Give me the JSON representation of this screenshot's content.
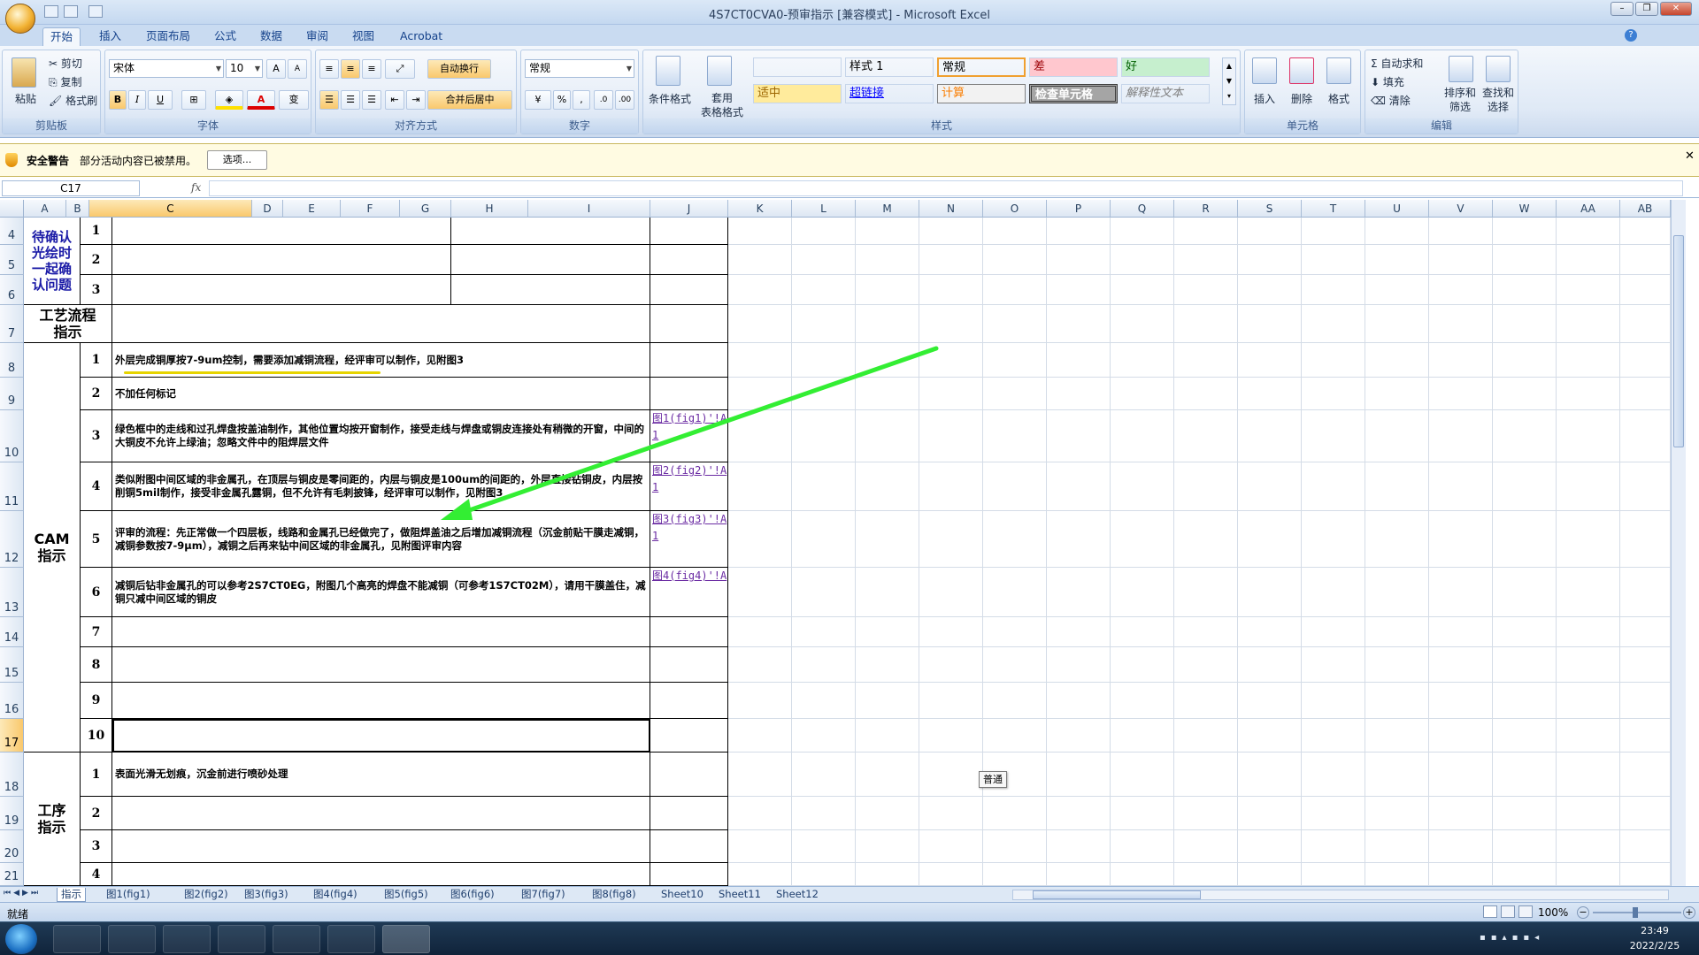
{
  "window": {
    "title": "4S7CT0CVA0-预审指示 [兼容模式] - Microsoft Excel"
  },
  "tabs": [
    "开始",
    "插入",
    "页面布局",
    "公式",
    "数据",
    "审阅",
    "视图",
    "Acrobat"
  ],
  "clipboard": {
    "paste": "粘贴",
    "cut": "剪切",
    "copy": "复制",
    "format_painter": "格式刷",
    "group": "剪贴板"
  },
  "font": {
    "name": "宋体",
    "size": "10",
    "group": "字体",
    "bold": "B",
    "italic": "I",
    "underline": "U",
    "grow": "A",
    "shrink": "A"
  },
  "alignment": {
    "wrap": "自动换行",
    "merge": "合并后居中",
    "group": "对齐方式"
  },
  "number": {
    "format": "常规",
    "group": "数字",
    "percent": "%",
    "comma": ","
  },
  "styles": {
    "conditional": "条件格式",
    "table": "套用\n表格格式",
    "cells": [
      {
        "label": "",
        "bg": "#ffffff",
        "color": "#000000"
      },
      {
        "label": "样式 1",
        "bg": "#ffffff",
        "color": "#000000"
      },
      {
        "label": "常规",
        "bg": "#ffffff",
        "color": "#000000"
      },
      {
        "label": "差",
        "bg": "#ffc7ce",
        "color": "#9c0006"
      },
      {
        "label": "好",
        "bg": "#c6efce",
        "color": "#006100"
      },
      {
        "label": "适中",
        "bg": "#ffeb9c",
        "color": "#9c6500"
      },
      {
        "label": "超链接",
        "bg": "#ffffff",
        "color": "#0000ff"
      },
      {
        "label": "计算",
        "bg": "#f2f2f2",
        "color": "#fa7d00"
      },
      {
        "label": "检查单元格",
        "bg": "#a5a5a5",
        "color": "#ffffff"
      },
      {
        "label": "解释性文本",
        "bg": "#ffffff",
        "color": "#7f7f7f"
      }
    ],
    "group": "样式"
  },
  "cells_group": {
    "insert": "插入",
    "delete": "删除",
    "format": "格式",
    "group": "单元格"
  },
  "editing": {
    "autosum": "自动求和",
    "fill": "填充",
    "clear": "清除",
    "sort": "排序和\n筛选",
    "find": "查找和\n选择",
    "group": "编辑"
  },
  "security": {
    "title": "安全警告",
    "message": "部分活动内容已被禁用。",
    "options": "选项..."
  },
  "formula": {
    "namebox": "C17",
    "fx": "fx",
    "value": ""
  },
  "columns": [
    "A",
    "B",
    "C",
    "D",
    "E",
    "F",
    "G",
    "H",
    "I",
    "J",
    "K",
    "L",
    "M",
    "N",
    "O",
    "P",
    "Q",
    "R",
    "S",
    "T",
    "U",
    "V",
    "W",
    "AA",
    "AB"
  ],
  "rows": [
    "4",
    "5",
    "6",
    "7",
    "8",
    "9",
    "10",
    "11",
    "12",
    "13",
    "14",
    "15",
    "16",
    "17",
    "18",
    "19",
    "20",
    "21"
  ],
  "sheet": {
    "confirm_label": "待确认光绘时一起确认问题",
    "confirm_nums": [
      "1",
      "2",
      "3"
    ],
    "process_label": "工艺流程指示",
    "cam_label": "CAM指示",
    "cam_items": [
      {
        "num": "1",
        "text": "外层完成铜厚按7-9um控制，需要添加减铜流程，经评审可以制作，见附图3",
        "link": ""
      },
      {
        "num": "2",
        "text": "不加任何标记",
        "link": ""
      },
      {
        "num": "3",
        "text": "绿色框中的走线和过孔焊盘按盖油制作，其他位置均按开窗制作，接受走线与焊盘或铜皮连接处有稍微的开窗，中间的大铜皮不允许上绿油；忽略文件中的阻焊层文件",
        "link": "图1(fig1)'!A1"
      },
      {
        "num": "4",
        "text": "类似附图中间区域的非金属孔，在顶层与铜皮是零间距的，内层与铜皮是100um的间距的，外层直接钻铜皮，内层按削铜5mil制作，接受非金属孔露铜，但不允许有毛刺披锋，经评审可以制作，见附图3",
        "link": "图2(fig2)'!A1"
      },
      {
        "num": "5",
        "text": "评审的流程：先正常做一个四层板，线路和金属孔已经做完了，做阻焊盖油之后增加减铜流程（沉金前贴干膜走减铜，减铜参数按7-9μm），减铜之后再来钻中间区域的非金属孔，见附图评审内容",
        "link": "图3(fig3)'!A1"
      },
      {
        "num": "6",
        "text": "减铜后钻非金属孔的可以参考2S7CT0EG，附图几个高亮的焊盘不能减铜（可参考1S7CT02M），请用干膜盖住，减铜只减中间区域的铜皮",
        "link": "图4(fig4)'!A"
      },
      {
        "num": "7",
        "text": "",
        "link": ""
      },
      {
        "num": "8",
        "text": "",
        "link": ""
      },
      {
        "num": "9",
        "text": "",
        "link": ""
      },
      {
        "num": "10",
        "text": "",
        "link": ""
      }
    ],
    "proc_label": "工序指示",
    "proc_items": [
      {
        "num": "1",
        "text": "表面光滑无划痕，沉金前进行喷砂处理"
      },
      {
        "num": "2",
        "text": ""
      },
      {
        "num": "3",
        "text": ""
      },
      {
        "num": "4",
        "text": ""
      }
    ]
  },
  "tooltip": "普通",
  "sheet_tabs": [
    "指示",
    "图1(fig1)",
    "图2(fig2)",
    "图3(fig3)",
    "图4(fig4)",
    "图5(fig5)",
    "图6(fig6)",
    "图7(fig7)",
    "图8(fig8)",
    "Sheet10",
    "Sheet11",
    "Sheet12"
  ],
  "status": {
    "mode": "就绪",
    "zoom": "100%"
  },
  "taskbar": {
    "time": "23:49",
    "date": "2022/2/25"
  },
  "colors": {
    "arrow": "#33ee33",
    "accent": "#15428b"
  }
}
